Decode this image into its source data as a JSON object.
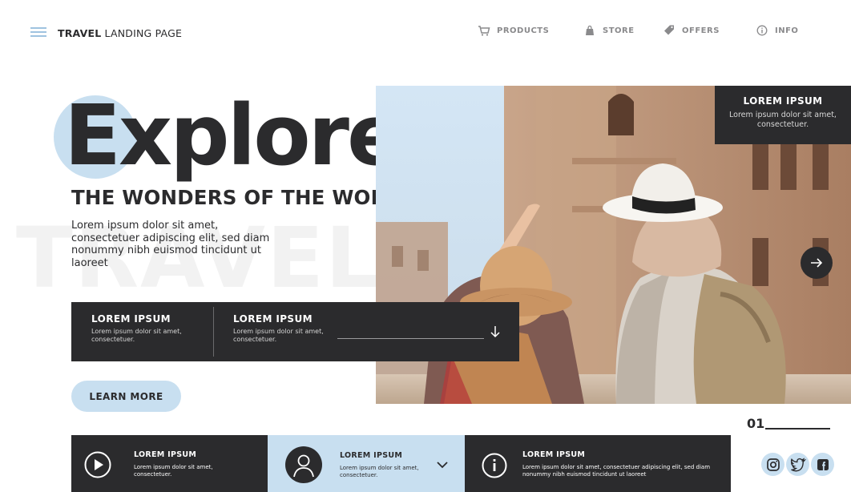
{
  "header": {
    "brand_bold": "TRAVEL",
    "brand_rest": " LANDING PAGE",
    "nav": [
      {
        "label": "PRODUCTS",
        "icon": "cart-icon"
      },
      {
        "label": "STORE",
        "icon": "bag-icon"
      },
      {
        "label": "OFFERS",
        "icon": "tag-icon"
      },
      {
        "label": "INFO",
        "icon": "info-icon"
      }
    ]
  },
  "hero": {
    "watermark": "TRAVEL",
    "title": "Explore",
    "subtitle": "THE WONDERS OF THE WORLD",
    "lead": "Lorem ipsum dolor sit amet, consectetuer adipiscing elit, sed diam nonummy nibh euismod tincidunt ut laoreet",
    "learn_more": "LEARN MORE"
  },
  "photo_box": {
    "title": "LOREM IPSUM",
    "text": "Lorem ipsum dolor sit amet, consectetuer."
  },
  "info_bar": {
    "col1_title": "LOREM IPSUM",
    "col1_text": "Lorem ipsum dolor sit amet, consectetuer.",
    "col2_title": "LOREM IPSUM",
    "col2_text": "Lorem ipsum dolor sit amet, consectetuer."
  },
  "pagination": {
    "current": "01"
  },
  "bottom_cards": [
    {
      "title": "LOREM IPSUM",
      "text": "Lorem ipsum dolor sit amet, consectetuer.",
      "icon": "play-icon"
    },
    {
      "title": "LOREM IPSUM",
      "text": "Lorem ipsum dolor sit amet, consectetuer.",
      "icon": "user-icon"
    },
    {
      "title": "LOREM IPSUM",
      "text": "Lorem ipsum dolor sit amet, consectetuer adipiscing elit, sed diam nonummy nibh euismod tincidunt ut laoreet",
      "icon": "info-circle-icon"
    }
  ],
  "social": [
    "instagram-icon",
    "twitter-icon",
    "facebook-icon"
  ],
  "colors": {
    "dark": "#2b2b2d",
    "accent": "#c8dff0",
    "nav_gray": "#8a8a8c"
  }
}
